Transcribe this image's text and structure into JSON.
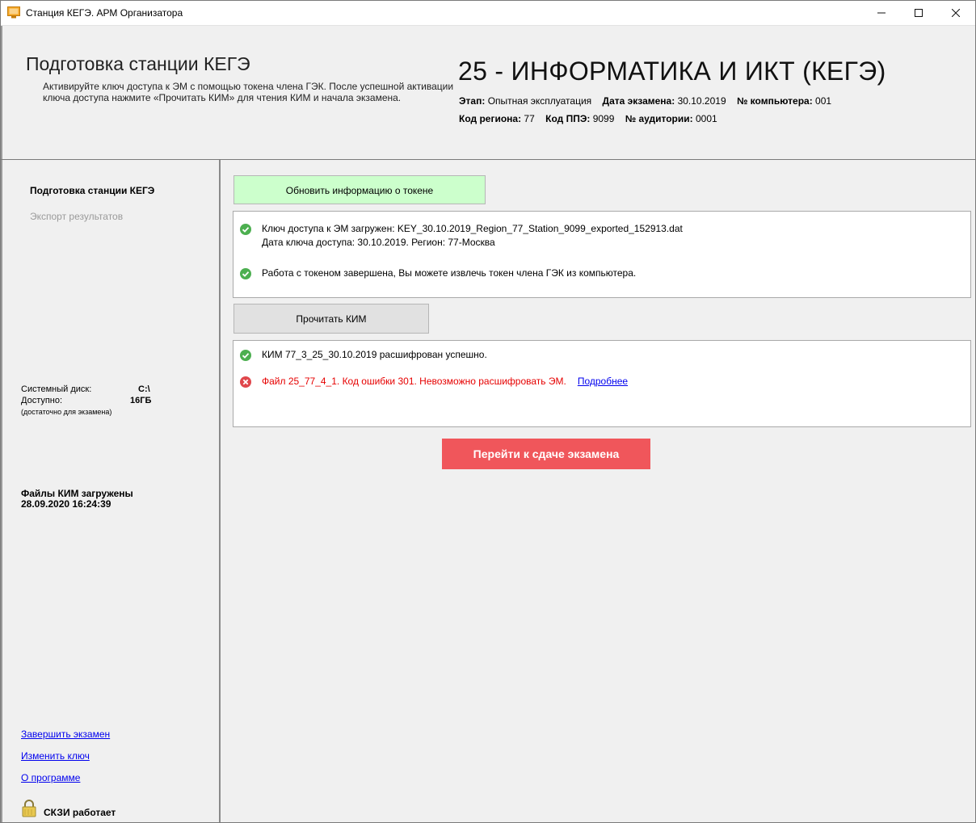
{
  "window": {
    "title": "Станция КЕГЭ. АРМ Организатора",
    "controls": {
      "minimize": "–",
      "maximize": "□",
      "close": "✕"
    }
  },
  "header": {
    "page_title": "Подготовка станции КЕГЭ",
    "description": "Активируйте ключ доступа к ЭМ с помощью токена члена ГЭК. После успешной активации ключа доступа нажмите «Прочитать КИМ» для чтения КИМ и начала экзамена.",
    "subject": "25 - ИНФОРМАТИКА И ИКТ (КЕГЭ)",
    "stage_label": "Этап:",
    "stage_value": "Опытная эксплуатация",
    "exam_date_label": "Дата экзамена:",
    "exam_date_value": "30.10.2019",
    "computer_label": "№ компьютера:",
    "computer_value": "001",
    "region_label": "Код региона:",
    "region_value": "77",
    "ppe_label": "Код ППЭ:",
    "ppe_value": "9099",
    "auditorium_label": "№ аудитории:",
    "auditorium_value": "0001"
  },
  "sidebar": {
    "nav_active": "Подготовка станции КЕГЭ",
    "nav_disabled": "Экспорт результатов",
    "disk_label": "Системный диск:",
    "disk_value": "C:\\",
    "free_label": "Доступно:",
    "free_value": "16ГБ",
    "free_note": "(достаточно для экзамена)",
    "kim_loaded_line1": "Файлы КИМ загружены",
    "kim_loaded_line2": "28.09.2020 16:24:39",
    "links": {
      "finish": "Завершить экзамен",
      "change_key": "Изменить ключ",
      "about": "О программе"
    },
    "skzi_status": "СКЗИ работает"
  },
  "main": {
    "refresh_button": "Обновить информацию о токене",
    "token_panel": {
      "msg1_line1": "Ключ доступа к ЭМ загружен: KEY_30.10.2019_Region_77_Station_9099_exported_152913.dat",
      "msg1_line2": "Дата ключа доступа: 30.10.2019. Регион: 77-Москва",
      "msg2": "Работа с токеном завершена, Вы можете извлечь токен члена ГЭК из компьютера."
    },
    "read_button": "Прочитать КИМ",
    "kim_panel": {
      "msg_success": "КИМ 77_3_25_30.10.2019 расшифрован успешно.",
      "msg_error": "Файл 25_77_4_1. Код ошибки 301. Невозможно расшифровать ЭМ.",
      "details_link": "Подробнее"
    },
    "go_button": "Перейти к сдаче экзамена"
  },
  "colors": {
    "success": "#4caf50",
    "error": "#e60000",
    "error_icon": "#e0474c",
    "go_button": "#f0565b",
    "refresh_button": "#ccffcc",
    "link": "#0000ee"
  },
  "icons": {
    "app": "monitor-icon",
    "success": "check-circle-icon",
    "error": "x-circle-icon",
    "lock": "lock-icon"
  }
}
